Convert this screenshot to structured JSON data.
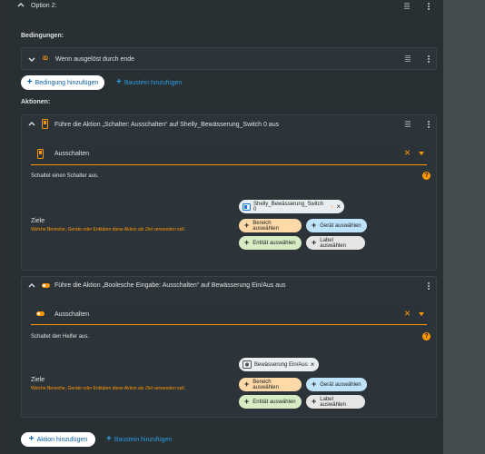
{
  "header": {
    "title": "Option 2:"
  },
  "conditions": {
    "heading": "Bedingungen:",
    "item_label": "Wenn ausgelöst durch ende",
    "item_badge": "ID",
    "add_condition": "Bedingung hinzufügen",
    "add_block": "Baustein hinzufügen"
  },
  "actions": {
    "heading": "Aktionen:",
    "action1": {
      "title": "Führe die Aktion „Schalter: Ausschalten“ auf Shelly_Bewässerung_Switch 0 aus",
      "select_value": "Ausschalten",
      "description": "Schaltet einen Schalter aus.",
      "targets_label": "Ziele",
      "targets_hint": "Welche Bereiche, Geräte oder Entitäten diese Aktion als Ziel verwenden soll.",
      "entity_chip": "Shelly_Bewässerung_Switch 0",
      "chips": {
        "area": "Bereich auswählen",
        "device": "Gerät auswählen",
        "entity": "Entität auswählen",
        "label": "Label auswählen"
      }
    },
    "action2": {
      "title": "Führe die Aktion „Boolesche Eingabe: Ausschalten“ auf Bewässerung Ein/Aus aus",
      "select_value": "Ausschalten",
      "description": "Schaltet den Helfer aus.",
      "targets_label": "Ziele",
      "targets_hint": "Welche Bereiche, Geräte oder Entitäten diese Aktion als Ziel verwenden soll.",
      "entity_chip": "Bewässerung Ein/Aus",
      "chips": {
        "area": "Bereich auswählen",
        "device": "Gerät auswählen",
        "entity": "Entität auswählen",
        "label": "Label auswählen"
      }
    },
    "add_action": "Aktion hinzufügen",
    "add_block": "Baustein hinzufügen"
  },
  "colors": {
    "accent": "#ff9800",
    "primary_blue": "#2f9be0",
    "area_chip": "#ffd9a8",
    "device_chip": "#bfe3fb",
    "entity_chip": "#d7ecc4",
    "label_chip": "#e6e6e6"
  }
}
